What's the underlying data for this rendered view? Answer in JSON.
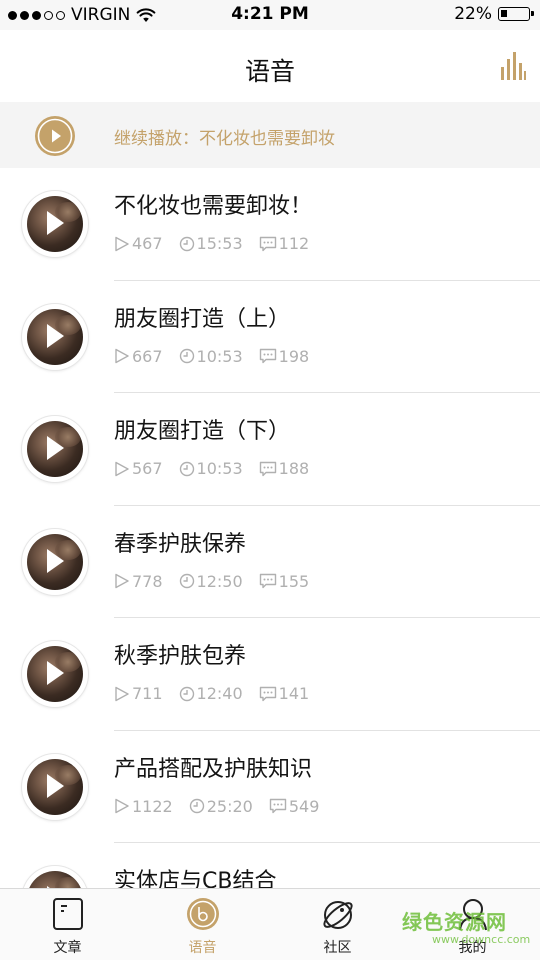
{
  "status_bar": {
    "carrier": "VIRGIN",
    "time": "4:21 PM",
    "battery": "22%",
    "battery_level": 0.22,
    "signal_bars": 3,
    "signal_total": 5
  },
  "header": {
    "title": "语音",
    "right_icon": "equalizer-icon"
  },
  "continue_bar": {
    "label": "继续播放：不化妆也需要卸妆",
    "icon": "play-circle-icon"
  },
  "accent_color": "#c4a26a",
  "episodes": [
    {
      "title": "不化妆也需要卸妆！",
      "plays": "467",
      "duration": "15:53",
      "comments": "112"
    },
    {
      "title": "朋友圈打造（上）",
      "plays": "667",
      "duration": "10:53",
      "comments": "198"
    },
    {
      "title": "朋友圈打造（下）",
      "plays": "567",
      "duration": "10:53",
      "comments": "188"
    },
    {
      "title": "春季护肤保养",
      "plays": "778",
      "duration": "12:50",
      "comments": "155"
    },
    {
      "title": "秋季护肤包养",
      "plays": "711",
      "duration": "12:40",
      "comments": "141"
    },
    {
      "title": "产品搭配及护肤知识",
      "plays": "1122",
      "duration": "25:20",
      "comments": "549"
    },
    {
      "title": "实体店与CB结合",
      "plays": "",
      "duration": "",
      "comments": ""
    }
  ],
  "tabs": [
    {
      "label": "文章",
      "icon": "article-icon",
      "active": false
    },
    {
      "label": "语音",
      "icon": "voice-icon",
      "active": true
    },
    {
      "label": "社区",
      "icon": "planet-icon",
      "active": false
    },
    {
      "label": "我的",
      "icon": "profile-icon",
      "active": false
    }
  ],
  "watermark": {
    "main": "绿色资源网",
    "sub": "www.downcc.com"
  }
}
